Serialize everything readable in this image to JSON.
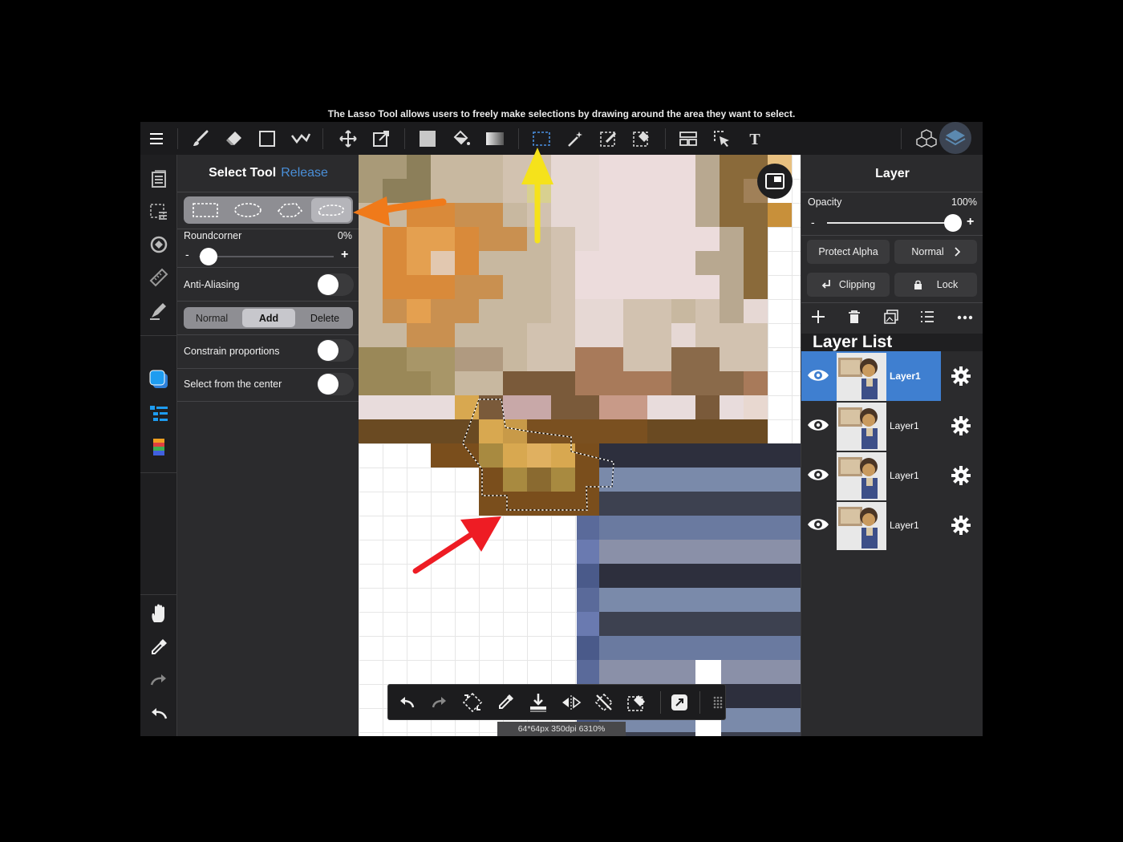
{
  "caption": "The Lasso Tool allows users to freely make selections by drawing around the area they want to select.",
  "toolbar": {
    "tools": [
      "menu-icon",
      "brush-icon",
      "eraser-icon",
      "shape-icon",
      "smudge-icon",
      "move-icon",
      "transform-icon",
      "fill-color-icon",
      "bucket-icon",
      "gradient-icon",
      "select-icon",
      "magic-wand-icon",
      "select-pen-icon",
      "select-eraser-icon",
      "frame-icon",
      "select-layer-icon",
      "text-icon",
      "materials-icon",
      "layers-icon"
    ]
  },
  "select_panel": {
    "title": "Select Tool",
    "release": "Release",
    "shapes": [
      "rectangle",
      "ellipse",
      "polygon",
      "lasso"
    ],
    "active_shape": "lasso",
    "roundcorner_label": "Roundcorner",
    "roundcorner_value": "0%",
    "minus": "-",
    "plus": "+",
    "anti_aliasing_label": "Anti-Aliasing",
    "modes": [
      "Normal",
      "Add",
      "Delete"
    ],
    "active_mode": "Add",
    "constrain_label": "Constrain proportions",
    "center_label": "Select from the center"
  },
  "layer_panel": {
    "title": "Layer",
    "opacity_label": "Opacity",
    "opacity_value": "100%",
    "minus": "-",
    "plus": "+",
    "protect_alpha": "Protect Alpha",
    "blend_mode": "Normal",
    "clipping": "Clipping",
    "lock": "Lock",
    "layer_list_label": "Layer List",
    "layers": [
      {
        "name": "Layer1",
        "selected": true
      },
      {
        "name": "Layer1",
        "selected": false
      },
      {
        "name": "Layer1",
        "selected": false
      },
      {
        "name": "Layer1",
        "selected": false
      }
    ]
  },
  "status": "64*64px 350dpi 6310%",
  "colors": {
    "accent": "#3f7fd0",
    "arrow_orange": "#f07a1a",
    "arrow_yellow": "#f5e21b",
    "arrow_red": "#ee1c24"
  }
}
